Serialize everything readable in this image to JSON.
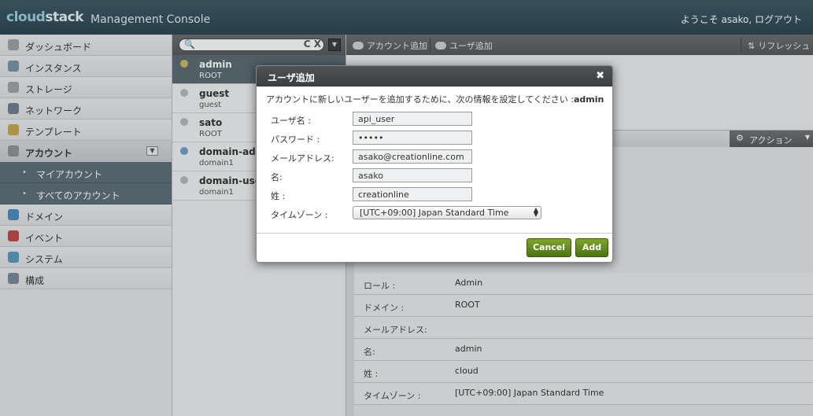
{
  "header": {
    "logo_a": "cloud",
    "logo_b": "stack",
    "title": "Management Console",
    "welcome": "ようこそ asako,",
    "logout": "ログアウト"
  },
  "sidebar": {
    "items": [
      {
        "label": "ダッシュボード",
        "icon": "dashboard-icon",
        "color": "#9aa3a8"
      },
      {
        "label": "インスタンス",
        "icon": "instance-icon",
        "color": "#7b94a8"
      },
      {
        "label": "ストレージ",
        "icon": "storage-icon",
        "color": "#a0a4a8"
      },
      {
        "label": "ネットワーク",
        "icon": "network-icon",
        "color": "#6e7f90"
      },
      {
        "label": "テンプレート",
        "icon": "template-icon",
        "color": "#c9a84a"
      },
      {
        "label": "アカウント",
        "icon": "account-icon",
        "color": "#8f9498"
      }
    ],
    "subitems": [
      {
        "label": "マイアカウント"
      },
      {
        "label": "すべてのアカウント"
      }
    ],
    "items2": [
      {
        "label": "ドメイン",
        "icon": "domain-icon",
        "color": "#4a8fc4"
      },
      {
        "label": "イベント",
        "icon": "event-icon",
        "color": "#c44a4a"
      },
      {
        "label": "システム",
        "icon": "system-icon",
        "color": "#5a9ac0"
      },
      {
        "label": "構成",
        "icon": "config-icon",
        "color": "#7a8a98"
      }
    ],
    "dot": "•",
    "collapse": "▼"
  },
  "search": {
    "mag": "🔍",
    "clear": "C X",
    "drop": "▼"
  },
  "accounts": [
    {
      "name": "admin",
      "domain": "ROOT"
    },
    {
      "name": "guest",
      "domain": "guest"
    },
    {
      "name": "sato",
      "domain": "ROOT"
    },
    {
      "name": "domain-admi",
      "domain": "domain1"
    },
    {
      "name": "domain-user-",
      "domain": "domain1"
    }
  ],
  "toolbar": {
    "add_account": "アカウント追加",
    "add_user": "ユーザ追加",
    "refresh": "リフレッシュ"
  },
  "action": {
    "label": "アクション",
    "gear": "⚙",
    "arrow": "▼"
  },
  "details": [
    {
      "key": "ロール :",
      "value": "Admin"
    },
    {
      "key": "ドメイン :",
      "value": "ROOT"
    },
    {
      "key": "メールアドレス:",
      "value": ""
    },
    {
      "key": "名:",
      "value": "admin"
    },
    {
      "key": "姓 :",
      "value": "cloud"
    },
    {
      "key": "タイムゾーン :",
      "value": "[UTC+09:00] Japan Standard Time"
    }
  ],
  "dialog": {
    "title": "ユーザ追加",
    "close": "✖",
    "desc_prefix": "アカウントに新しいユーザーを追加するために、次の情報を設定してください :",
    "desc_account": "admin",
    "fields": [
      {
        "label": "ユーザ名 :",
        "value": "api_user"
      },
      {
        "label": "パスワード :",
        "value": "•••••"
      },
      {
        "label": "メールアドレス:",
        "value": "asako@creationline.com"
      },
      {
        "label": "名:",
        "value": "asako"
      },
      {
        "label": "姓 :",
        "value": "creationline"
      }
    ],
    "timezone_label": "タイムゾーン :",
    "timezone_value": "[UTC+09:00] Japan Standard Time",
    "cancel": "Cancel",
    "add": "Add"
  }
}
